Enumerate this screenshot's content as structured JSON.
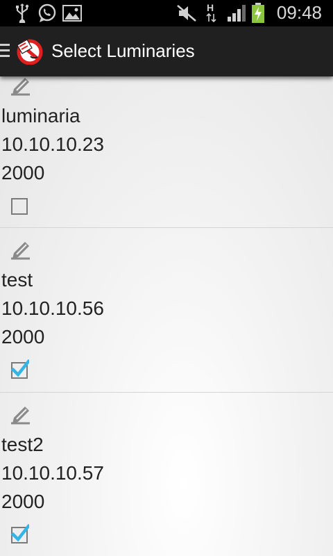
{
  "status_bar": {
    "time": "09:48",
    "left_icons": [
      "usb-icon",
      "whatsapp-icon",
      "gallery-icon"
    ],
    "right_icons": [
      "mute-icon",
      "hspa-data-icon",
      "signal-icon",
      "battery-charging-icon"
    ],
    "battery_color": "#8cc63f"
  },
  "action_bar": {
    "title": "Select Luminaries",
    "logo_color": "#e02020"
  },
  "luminaries": [
    {
      "name": "luminaria",
      "ip": "10.10.10.23",
      "port": "2000",
      "checked": false
    },
    {
      "name": "test",
      "ip": "10.10.10.56",
      "port": "2000",
      "checked": true
    },
    {
      "name": "test2",
      "ip": "10.10.10.57",
      "port": "2000",
      "checked": true
    }
  ],
  "accent_color": "#33b5e5"
}
